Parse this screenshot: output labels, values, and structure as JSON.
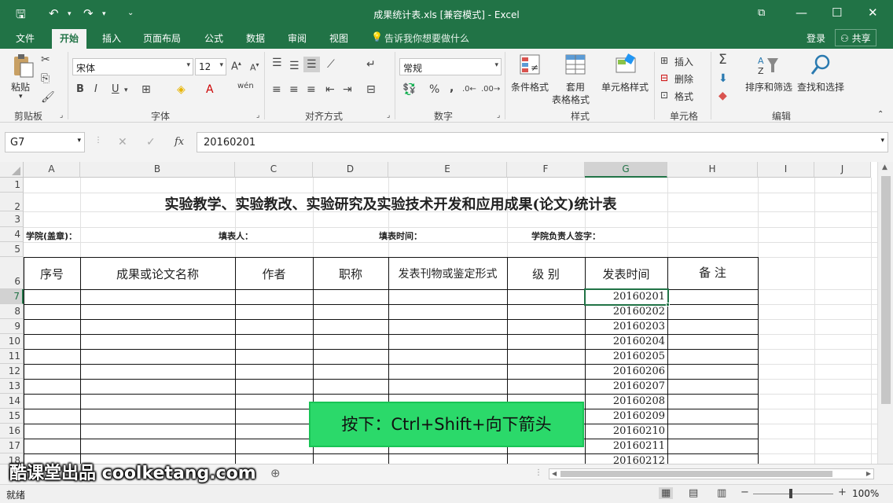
{
  "window": {
    "title": "成果统计表.xls  [兼容模式] - Excel"
  },
  "tabs": [
    {
      "label": "文件"
    },
    {
      "label": "开始"
    },
    {
      "label": "插入"
    },
    {
      "label": "页面布局"
    },
    {
      "label": "公式"
    },
    {
      "label": "数据"
    },
    {
      "label": "审阅"
    },
    {
      "label": "视图"
    }
  ],
  "tellme": "告诉我你想要做什么",
  "login": "登录",
  "share": "共享",
  "ribbon": {
    "paste": "粘贴",
    "clipboard": "剪贴板",
    "font_name": "宋体",
    "font_size": "12",
    "font_group": "字体",
    "align_group": "对齐方式",
    "number_format": "常规",
    "number_group": "数字",
    "cond_format": "条件格式",
    "table_format_1": "套用",
    "table_format_2": "表格格式",
    "cell_style": "单元格样式",
    "style_group": "样式",
    "insert": "插入",
    "delete": "删除",
    "format": "格式",
    "cells_group": "单元格",
    "sort_filter": "排序和筛选",
    "find_select": "查找和选择",
    "edit_group": "编辑",
    "bold": "B",
    "italic": "I",
    "underline": "U",
    "percent": "%",
    "comma": ","
  },
  "formula_bar": {
    "name_box": "G7",
    "fx": "fx",
    "value": "20160201"
  },
  "sheet": {
    "columns": [
      "A",
      "B",
      "C",
      "D",
      "E",
      "F",
      "G",
      "H",
      "I",
      "J"
    ],
    "rows": [
      "1",
      "2",
      "3",
      "4",
      "5",
      "6",
      "7",
      "8",
      "9",
      "10",
      "11",
      "12",
      "13",
      "14",
      "15",
      "16",
      "17",
      "18"
    ],
    "title": "实验教学、实验教改、实验研究及实验技术开发和应用成果(论文)统计表",
    "row4": {
      "college": "学院(盖章)：",
      "filler": "填表人：",
      "fill_time": "填表时间：",
      "signer": "学院负责人签字："
    },
    "headers": [
      "序号",
      "成果或论文名称",
      "作者",
      "职称",
      "发表刊物或鉴定形式",
      "级 别",
      "发表时间",
      "备 注"
    ],
    "dates": [
      "20160201",
      "20160202",
      "20160203",
      "20160204",
      "20160205",
      "20160206",
      "20160207",
      "20160208",
      "20160209",
      "20160210",
      "20160211",
      "20160212"
    ]
  },
  "key_hint": "按下：Ctrl+Shift+向下箭头",
  "watermark": "酷课堂出品 coolketang.com",
  "status": {
    "ready": "就绪",
    "zoom": "100%"
  }
}
